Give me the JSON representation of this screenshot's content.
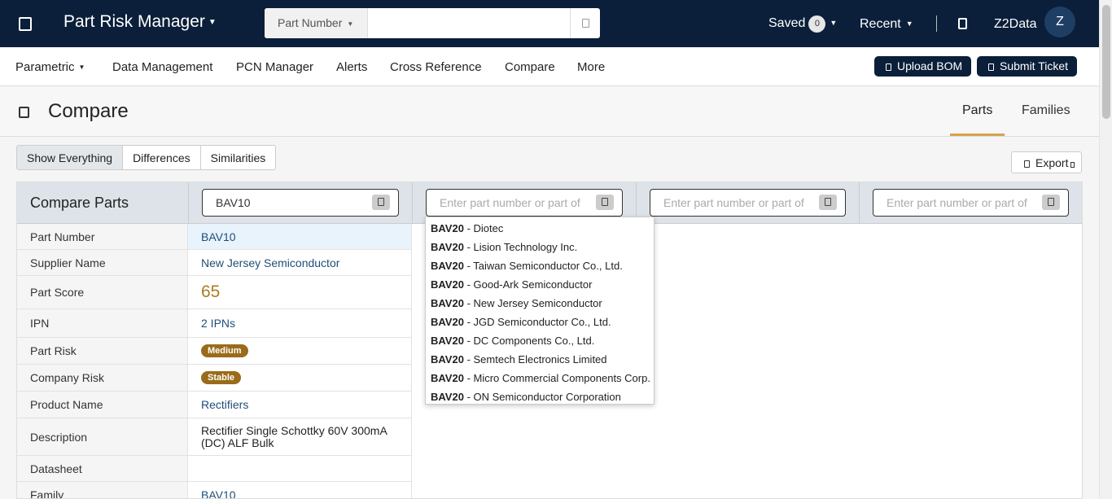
{
  "header": {
    "app_title": "Part Risk Manager",
    "search_type": "Part Number",
    "search_value": "",
    "saved_label": "Saved",
    "saved_count": "0",
    "recent_label": "Recent",
    "user_name": "Z2Data",
    "avatar_initial": "Z"
  },
  "nav": {
    "items": [
      "Parametric",
      "Data Management",
      "PCN Manager",
      "Alerts",
      "Cross Reference",
      "Compare",
      "More"
    ],
    "upload_bom": "Upload BOM",
    "submit_ticket": "Submit Ticket"
  },
  "page": {
    "title": "Compare",
    "tabs": [
      "Parts",
      "Families"
    ],
    "active_tab": "Parts"
  },
  "view_toggle": {
    "options": [
      "Show Everything",
      "Differences",
      "Similarities"
    ],
    "active": "Show Everything"
  },
  "export_label": "Export",
  "compare": {
    "title": "Compare Parts",
    "slots": [
      {
        "value": "BAV10",
        "placeholder": "Enter part number or part of"
      },
      {
        "value": "",
        "placeholder": "Enter part number or part of"
      },
      {
        "value": "",
        "placeholder": "Enter part number or part of"
      },
      {
        "value": "",
        "placeholder": "Enter part number or part of"
      }
    ],
    "rows": [
      {
        "label": "Part Number",
        "value": "BAV10"
      },
      {
        "label": "Supplier Name",
        "value": "New Jersey Semiconductor"
      },
      {
        "label": "Part Score",
        "value": "65"
      },
      {
        "label": "IPN",
        "value": "2 IPNs"
      },
      {
        "label": "Part Risk",
        "value": "Medium"
      },
      {
        "label": "Company Risk",
        "value": "Stable"
      },
      {
        "label": "Product Name",
        "value": "Rectifiers"
      },
      {
        "label": "Description",
        "value": "Rectifier Single Schottky 60V 300mA (DC) ALF Bulk"
      },
      {
        "label": "Datasheet",
        "value": ""
      },
      {
        "label": "Family",
        "value": "BAV10"
      }
    ]
  },
  "suggestions": [
    {
      "part": "BAV20",
      "supplier": " - Diotec"
    },
    {
      "part": "BAV20",
      "supplier": " - Lision Technology Inc."
    },
    {
      "part": "BAV20",
      "supplier": " - Taiwan Semiconductor Co., Ltd."
    },
    {
      "part": "BAV20",
      "supplier": " - Good-Ark Semiconductor"
    },
    {
      "part": "BAV20",
      "supplier": " - New Jersey Semiconductor"
    },
    {
      "part": "BAV20",
      "supplier": " - JGD Semiconductor Co., Ltd."
    },
    {
      "part": "BAV20",
      "supplier": " - DC Components Co., Ltd."
    },
    {
      "part": "BAV20",
      "supplier": " - Semtech Electronics Limited"
    },
    {
      "part": "BAV20",
      "supplier": " - Micro Commercial Components Corp."
    },
    {
      "part": "BAV20",
      "supplier": " - ON Semiconductor Corporation"
    }
  ],
  "colors": {
    "topbar": "#0b1f3a",
    "accent": "#d6a34a",
    "badge": "#9a6b1a",
    "link": "#1f4e79"
  }
}
